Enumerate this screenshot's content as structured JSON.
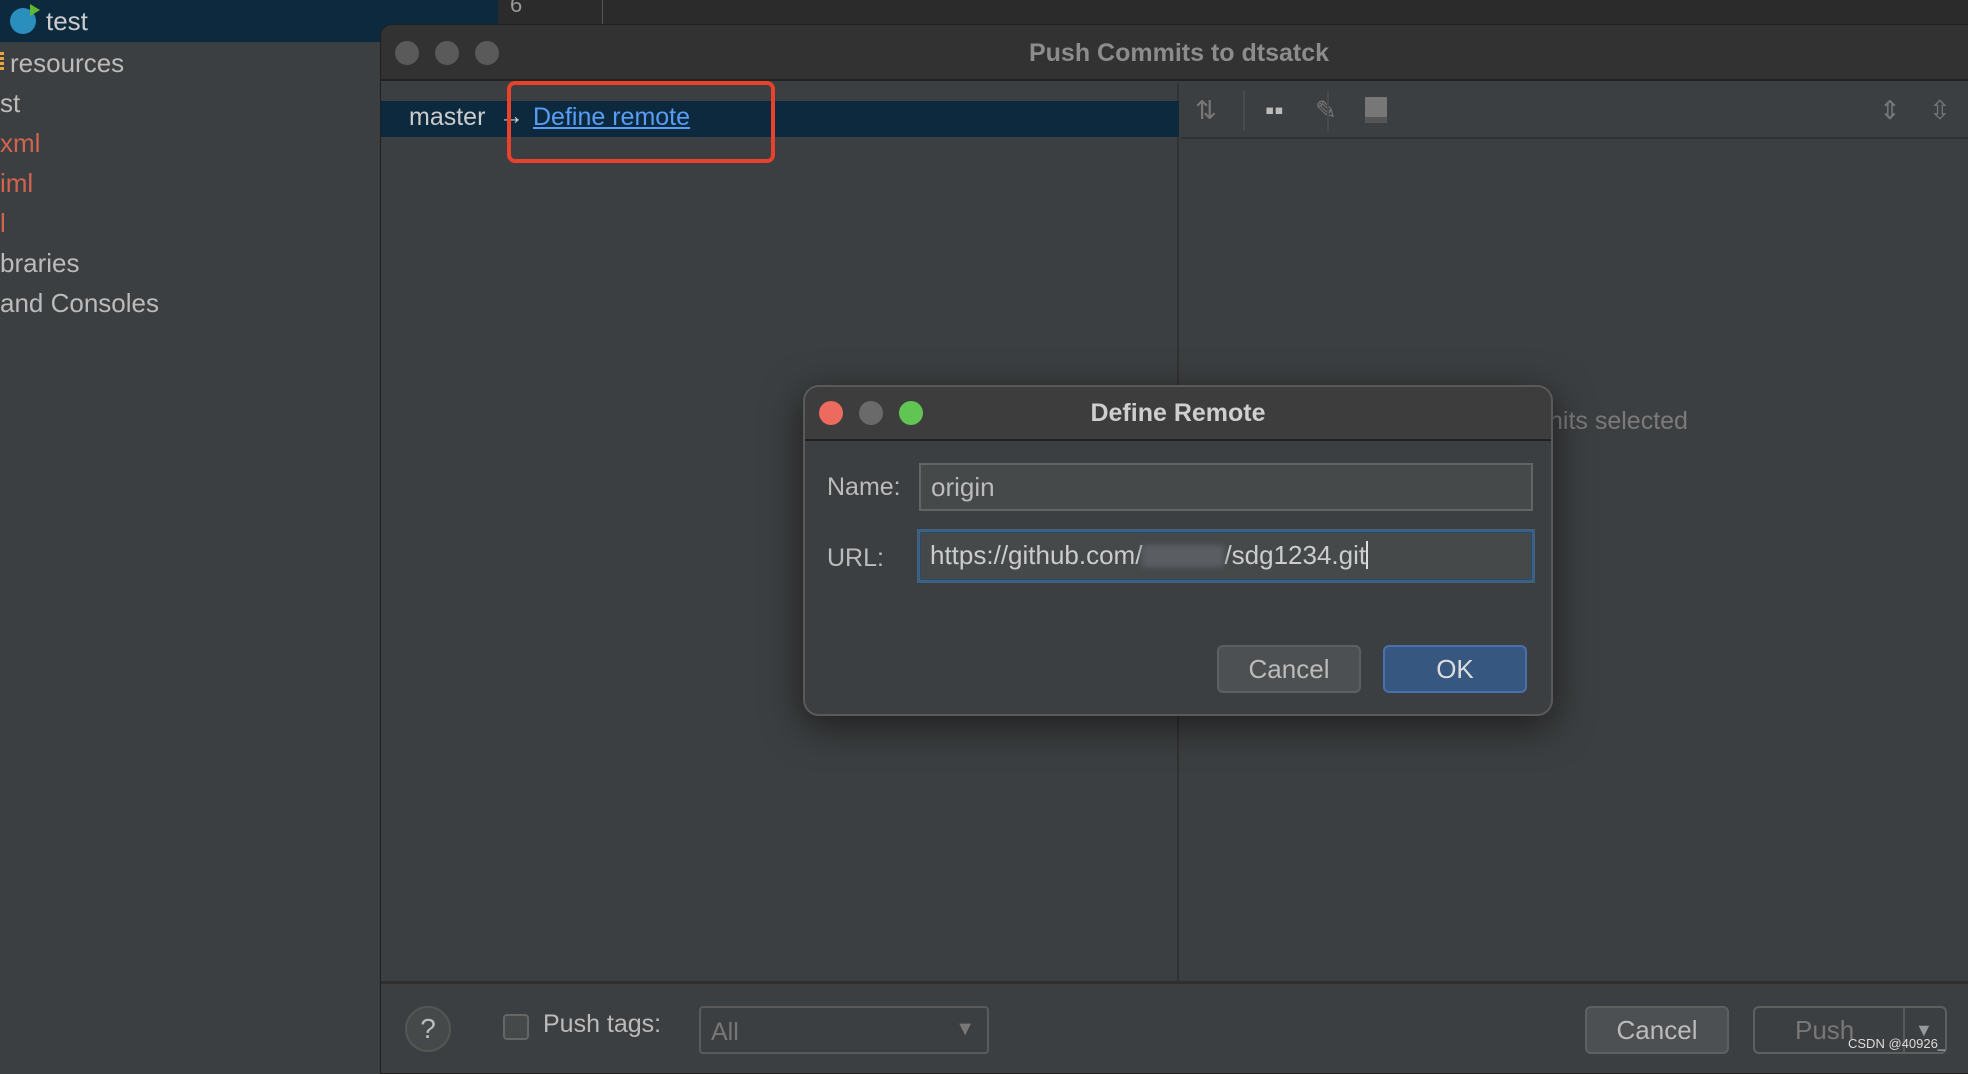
{
  "sidebar": {
    "items": [
      {
        "label": "test",
        "icon": "module-icon"
      },
      {
        "label": "resources",
        "icon": "folder-resources-icon"
      },
      {
        "label": "st"
      },
      {
        "label": "xml",
        "status": "untracked"
      },
      {
        "label": "iml",
        "status": "untracked"
      },
      {
        "label": "l",
        "status": "untracked"
      },
      {
        "label": "braries"
      },
      {
        "label": "and Consoles"
      }
    ]
  },
  "editor": {
    "line_number": "6"
  },
  "push_dialog": {
    "title": "Push Commits to dtsatck",
    "branch": "master",
    "arrow": "→",
    "define_remote_link": "Define remote",
    "empty_text": "nits selected",
    "toolbar_icons": [
      "cherry-pick-icon",
      "group-by-icon",
      "edit-icon",
      "preview-icon",
      "expand-all-icon",
      "collapse-all-icon"
    ],
    "help_label": "?",
    "push_tags_label": "Push tags:",
    "push_tags_checked": false,
    "push_tags_value": "All",
    "cancel_label": "Cancel",
    "push_label": "Push"
  },
  "define_remote": {
    "title": "Define Remote",
    "name_label": "Name:",
    "name_value": "origin",
    "url_label": "URL:",
    "url_prefix": "https://github.com/",
    "url_suffix": "/sdg1234.git",
    "cancel_label": "Cancel",
    "ok_label": "OK"
  },
  "colors": {
    "accent": "#365880",
    "link": "#589df6",
    "highlight_box": "#e8412c",
    "untracked": "#d2644f",
    "selection": "#0d293e"
  },
  "watermark": "CSDN @40926_"
}
